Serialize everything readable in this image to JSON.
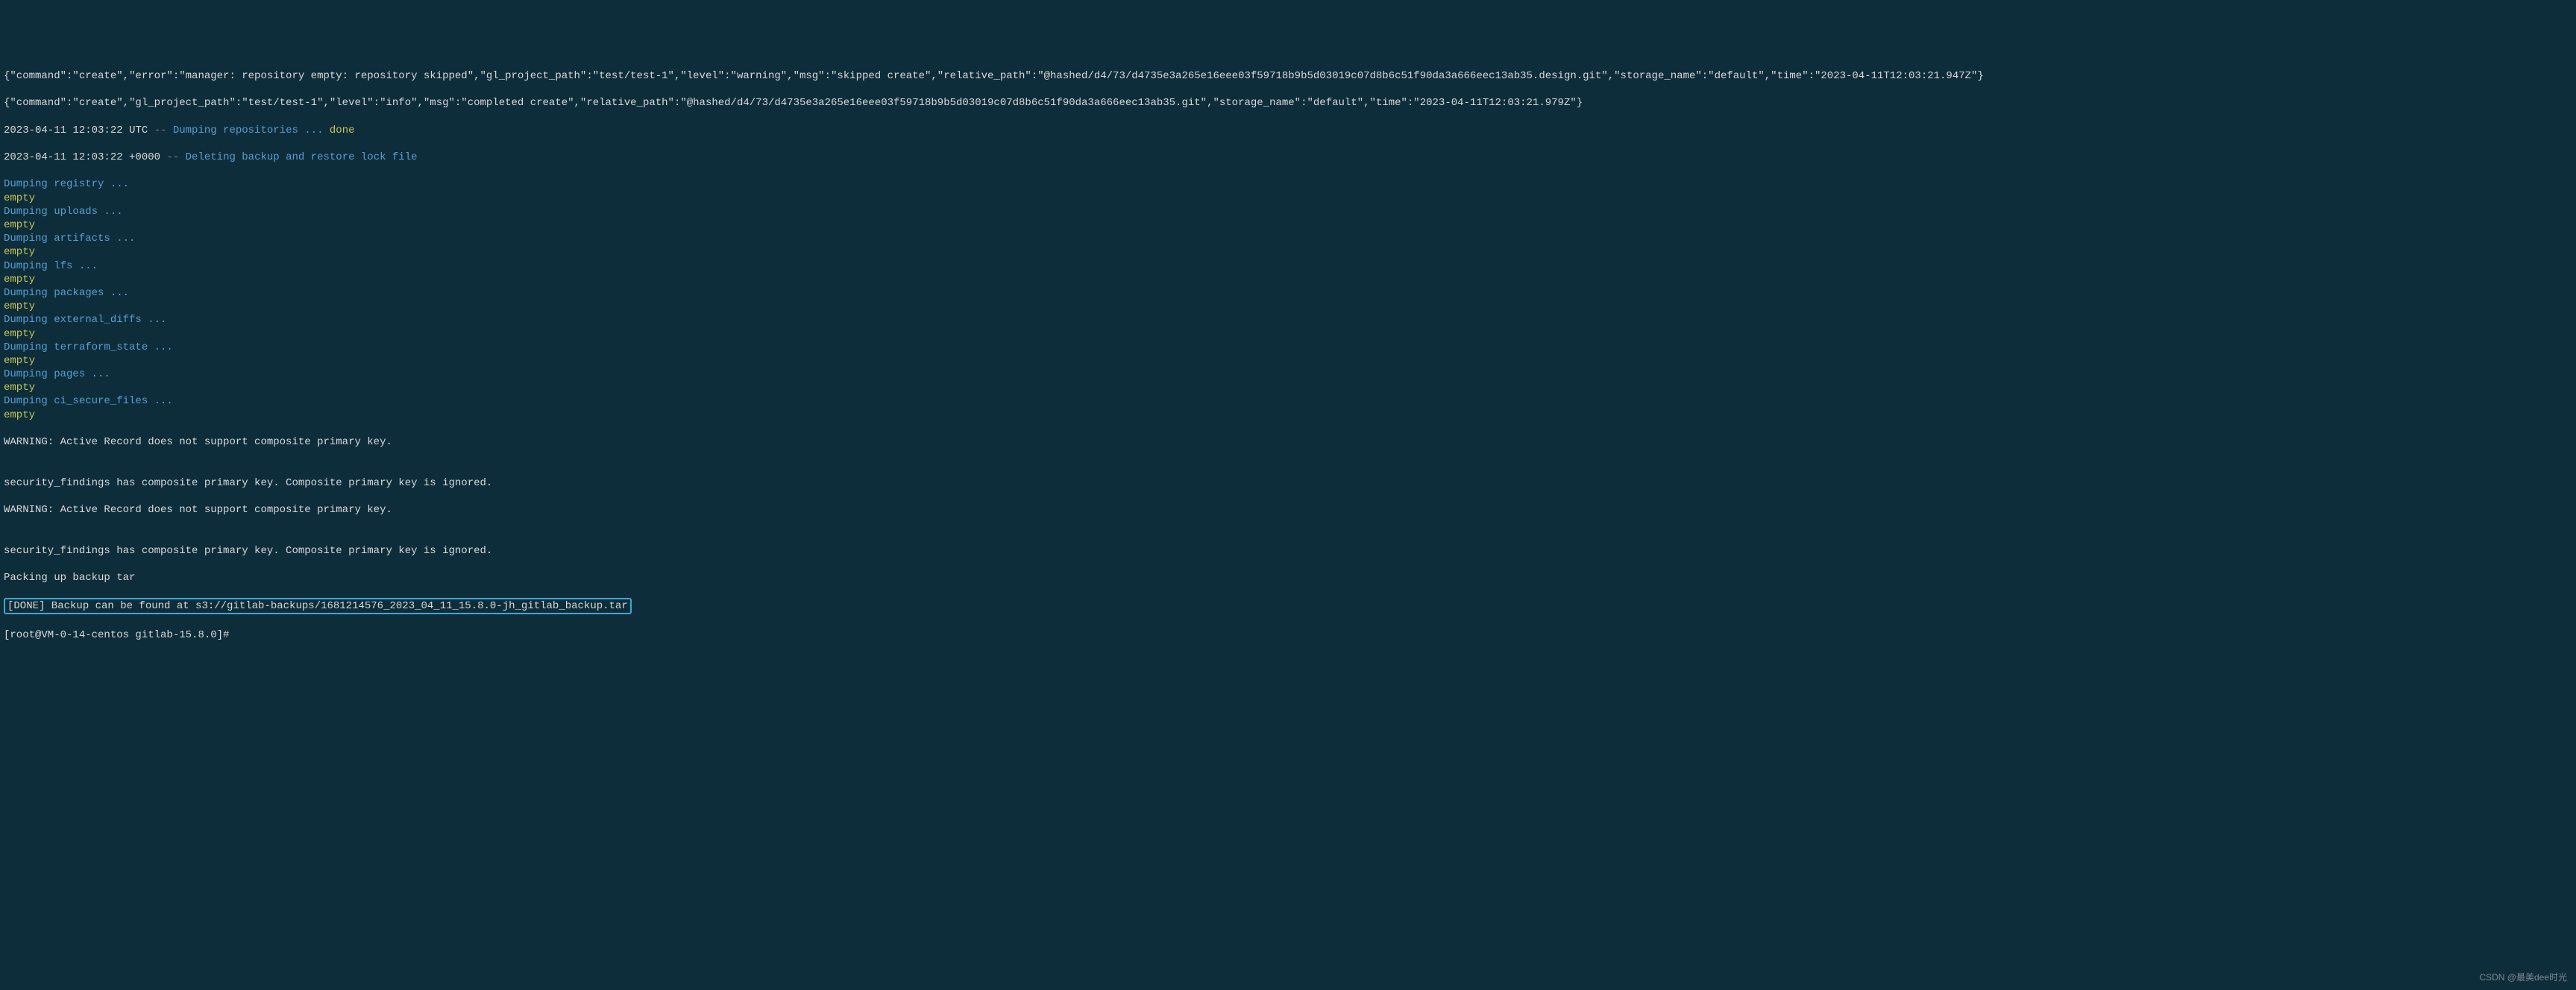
{
  "log": {
    "json_line1": "{\"command\":\"create\",\"error\":\"manager: repository empty: repository skipped\",\"gl_project_path\":\"test/test-1\",\"level\":\"warning\",\"msg\":\"skipped create\",\"relative_path\":\"@hashed/d4/73/d4735e3a265e16eee03f59718b9b5d03019c07d8b6c51f90da3a666eec13ab35.design.git\",\"storage_name\":\"default\",\"time\":\"2023-04-11T12:03:21.947Z\"}",
    "json_line2": "{\"command\":\"create\",\"gl_project_path\":\"test/test-1\",\"level\":\"info\",\"msg\":\"completed create\",\"relative_path\":\"@hashed/d4/73/d4735e3a265e16eee03f59718b9b5d03019c07d8b6c51f90da3a666eec13ab35.git\",\"storage_name\":\"default\",\"time\":\"2023-04-11T12:03:21.979Z\"}",
    "ts1": "2023-04-11 12:03:22 UTC",
    "sep": " -- ",
    "dump_repos": "Dumping repositories ... ",
    "done": "done",
    "ts2": "2023-04-11 12:03:22 +0000",
    "delete_lock": "Deleting backup and restore lock file",
    "sections": [
      {
        "label": "Dumping registry ...",
        "status": "empty"
      },
      {
        "label": "Dumping uploads ...",
        "status": "empty"
      },
      {
        "label": "Dumping artifacts ...",
        "status": "empty"
      },
      {
        "label": "Dumping lfs ...",
        "status": "empty"
      },
      {
        "label": "Dumping packages ...",
        "status": "empty"
      },
      {
        "label": "Dumping external_diffs ...",
        "status": "empty"
      },
      {
        "label": "Dumping terraform_state ...",
        "status": "empty"
      },
      {
        "label": "Dumping pages ...",
        "status": "empty"
      },
      {
        "label": "Dumping ci_secure_files ...",
        "status": "empty"
      }
    ],
    "warn1": "WARNING: Active Record does not support composite primary key.",
    "blank": "",
    "secfind1": "security_findings has composite primary key. Composite primary key is ignored.",
    "warn2": "WARNING: Active Record does not support composite primary key.",
    "secfind2": "security_findings has composite primary key. Composite primary key is ignored.",
    "packing": "Packing up backup tar",
    "done_box": "[DONE] Backup can be found at s3://gitlab-backups/1681214576_2023_04_11_15.8.0-jh_gitlab_backup.tar",
    "prompt": "[root@VM-0-14-centos gitlab-15.8.0]# "
  },
  "watermark": "CSDN @最美dee时光"
}
